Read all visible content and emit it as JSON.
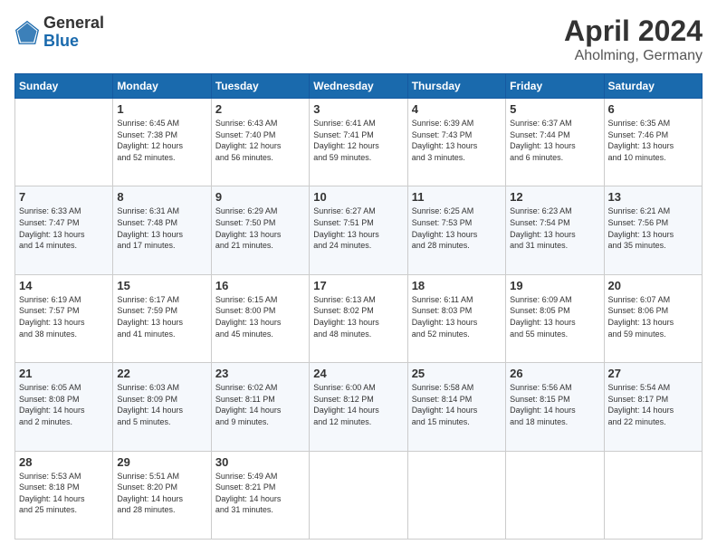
{
  "header": {
    "logo_general": "General",
    "logo_blue": "Blue",
    "month_title": "April 2024",
    "location": "Aholming, Germany"
  },
  "days_of_week": [
    "Sunday",
    "Monday",
    "Tuesday",
    "Wednesday",
    "Thursday",
    "Friday",
    "Saturday"
  ],
  "weeks": [
    [
      {
        "day": "",
        "info": ""
      },
      {
        "day": "1",
        "info": "Sunrise: 6:45 AM\nSunset: 7:38 PM\nDaylight: 12 hours\nand 52 minutes."
      },
      {
        "day": "2",
        "info": "Sunrise: 6:43 AM\nSunset: 7:40 PM\nDaylight: 12 hours\nand 56 minutes."
      },
      {
        "day": "3",
        "info": "Sunrise: 6:41 AM\nSunset: 7:41 PM\nDaylight: 12 hours\nand 59 minutes."
      },
      {
        "day": "4",
        "info": "Sunrise: 6:39 AM\nSunset: 7:43 PM\nDaylight: 13 hours\nand 3 minutes."
      },
      {
        "day": "5",
        "info": "Sunrise: 6:37 AM\nSunset: 7:44 PM\nDaylight: 13 hours\nand 6 minutes."
      },
      {
        "day": "6",
        "info": "Sunrise: 6:35 AM\nSunset: 7:46 PM\nDaylight: 13 hours\nand 10 minutes."
      }
    ],
    [
      {
        "day": "7",
        "info": "Sunrise: 6:33 AM\nSunset: 7:47 PM\nDaylight: 13 hours\nand 14 minutes."
      },
      {
        "day": "8",
        "info": "Sunrise: 6:31 AM\nSunset: 7:48 PM\nDaylight: 13 hours\nand 17 minutes."
      },
      {
        "day": "9",
        "info": "Sunrise: 6:29 AM\nSunset: 7:50 PM\nDaylight: 13 hours\nand 21 minutes."
      },
      {
        "day": "10",
        "info": "Sunrise: 6:27 AM\nSunset: 7:51 PM\nDaylight: 13 hours\nand 24 minutes."
      },
      {
        "day": "11",
        "info": "Sunrise: 6:25 AM\nSunset: 7:53 PM\nDaylight: 13 hours\nand 28 minutes."
      },
      {
        "day": "12",
        "info": "Sunrise: 6:23 AM\nSunset: 7:54 PM\nDaylight: 13 hours\nand 31 minutes."
      },
      {
        "day": "13",
        "info": "Sunrise: 6:21 AM\nSunset: 7:56 PM\nDaylight: 13 hours\nand 35 minutes."
      }
    ],
    [
      {
        "day": "14",
        "info": "Sunrise: 6:19 AM\nSunset: 7:57 PM\nDaylight: 13 hours\nand 38 minutes."
      },
      {
        "day": "15",
        "info": "Sunrise: 6:17 AM\nSunset: 7:59 PM\nDaylight: 13 hours\nand 41 minutes."
      },
      {
        "day": "16",
        "info": "Sunrise: 6:15 AM\nSunset: 8:00 PM\nDaylight: 13 hours\nand 45 minutes."
      },
      {
        "day": "17",
        "info": "Sunrise: 6:13 AM\nSunset: 8:02 PM\nDaylight: 13 hours\nand 48 minutes."
      },
      {
        "day": "18",
        "info": "Sunrise: 6:11 AM\nSunset: 8:03 PM\nDaylight: 13 hours\nand 52 minutes."
      },
      {
        "day": "19",
        "info": "Sunrise: 6:09 AM\nSunset: 8:05 PM\nDaylight: 13 hours\nand 55 minutes."
      },
      {
        "day": "20",
        "info": "Sunrise: 6:07 AM\nSunset: 8:06 PM\nDaylight: 13 hours\nand 59 minutes."
      }
    ],
    [
      {
        "day": "21",
        "info": "Sunrise: 6:05 AM\nSunset: 8:08 PM\nDaylight: 14 hours\nand 2 minutes."
      },
      {
        "day": "22",
        "info": "Sunrise: 6:03 AM\nSunset: 8:09 PM\nDaylight: 14 hours\nand 5 minutes."
      },
      {
        "day": "23",
        "info": "Sunrise: 6:02 AM\nSunset: 8:11 PM\nDaylight: 14 hours\nand 9 minutes."
      },
      {
        "day": "24",
        "info": "Sunrise: 6:00 AM\nSunset: 8:12 PM\nDaylight: 14 hours\nand 12 minutes."
      },
      {
        "day": "25",
        "info": "Sunrise: 5:58 AM\nSunset: 8:14 PM\nDaylight: 14 hours\nand 15 minutes."
      },
      {
        "day": "26",
        "info": "Sunrise: 5:56 AM\nSunset: 8:15 PM\nDaylight: 14 hours\nand 18 minutes."
      },
      {
        "day": "27",
        "info": "Sunrise: 5:54 AM\nSunset: 8:17 PM\nDaylight: 14 hours\nand 22 minutes."
      }
    ],
    [
      {
        "day": "28",
        "info": "Sunrise: 5:53 AM\nSunset: 8:18 PM\nDaylight: 14 hours\nand 25 minutes."
      },
      {
        "day": "29",
        "info": "Sunrise: 5:51 AM\nSunset: 8:20 PM\nDaylight: 14 hours\nand 28 minutes."
      },
      {
        "day": "30",
        "info": "Sunrise: 5:49 AM\nSunset: 8:21 PM\nDaylight: 14 hours\nand 31 minutes."
      },
      {
        "day": "",
        "info": ""
      },
      {
        "day": "",
        "info": ""
      },
      {
        "day": "",
        "info": ""
      },
      {
        "day": "",
        "info": ""
      }
    ]
  ]
}
